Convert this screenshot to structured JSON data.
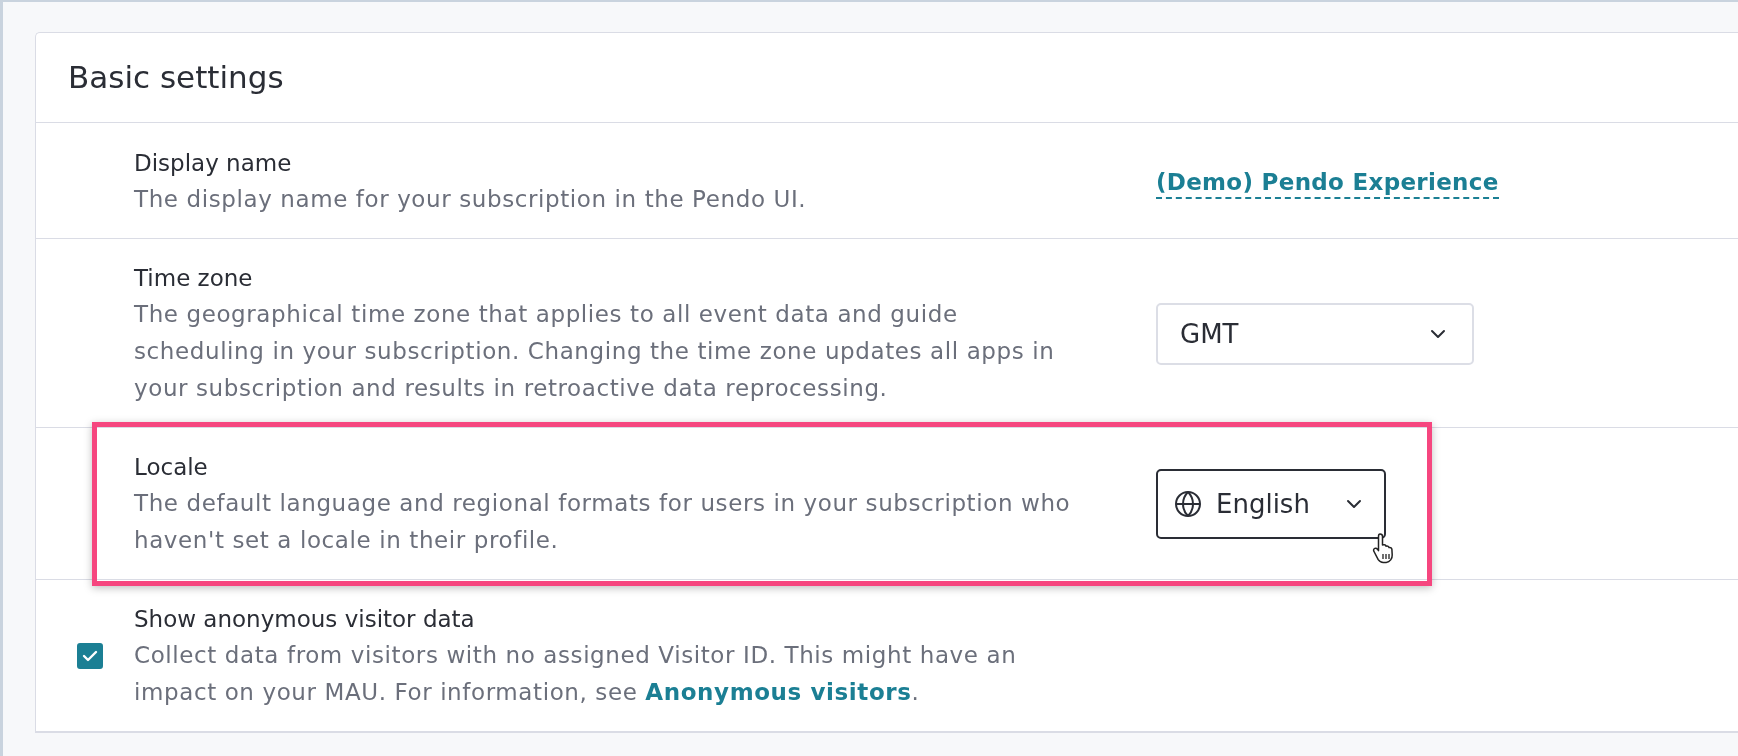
{
  "title": "Basic settings",
  "settings": [
    {
      "kind": "link",
      "label": "Display name",
      "description": "The display name for your subscription in the Pendo UI.",
      "value": "(Demo) Pendo Experience",
      "highlighted": false,
      "hovered": false
    },
    {
      "kind": "select",
      "label": "Time zone",
      "description": "The geographical time zone that applies to all event data and guide scheduling in your subscription. Changing the time zone updates all apps in your subscription and results in retroactive data reprocessing.",
      "value": "GMT",
      "highlighted": false,
      "hovered": false
    },
    {
      "kind": "language-select",
      "label": "Locale",
      "description": "The default language and regional formats for users in your subscription who haven't set a locale in their profile.",
      "value": "English",
      "highlighted": true,
      "hovered": true
    },
    {
      "kind": "checkbox",
      "label": "Show anonymous visitor data",
      "description": "Collect data from visitors with no assigned Visitor ID. This might have an impact on your MAU. For information, see ",
      "link": "Anonymous visitors",
      "description_end": ".",
      "checked": true,
      "highlighted": false,
      "hovered": false
    }
  ]
}
